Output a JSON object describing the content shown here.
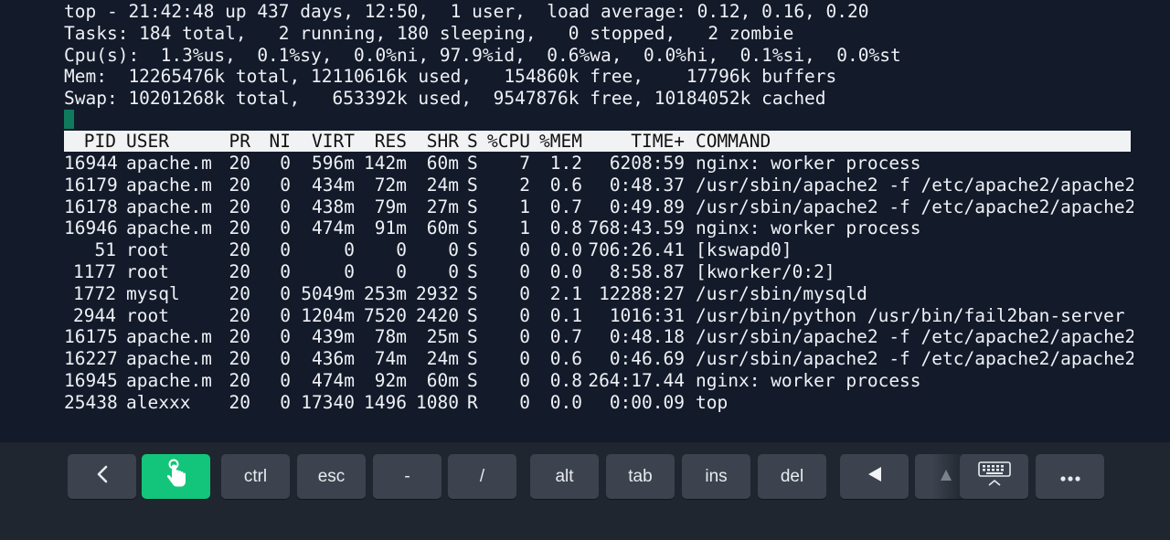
{
  "summary": {
    "line1": "top - 21:42:48 up 437 days, 12:50,  1 user,  load average: 0.12, 0.16, 0.20",
    "line2": "Tasks: 184 total,   2 running, 180 sleeping,   0 stopped,   2 zombie",
    "line3": "Cpu(s):  1.3%us,  0.1%sy,  0.0%ni, 97.9%id,  0.6%wa,  0.0%hi,  0.1%si,  0.0%st",
    "line4": "Mem:  12265476k total, 12110616k used,   154860k free,    17796k buffers",
    "line5": "Swap: 10201268k total,   653392k used,  9547876k free, 10184052k cached"
  },
  "columns": {
    "pid": "PID",
    "user": "USER",
    "pr": "PR",
    "ni": "NI",
    "virt": "VIRT",
    "res": "RES",
    "shr": "SHR",
    "s": "S",
    "cpu": "%CPU",
    "mem": "%MEM",
    "time": "TIME+",
    "command": "COMMAND"
  },
  "processes": [
    {
      "pid": "16944",
      "user": "apache.m",
      "pr": "20",
      "ni": "0",
      "virt": "596m",
      "res": "142m",
      "shr": "60m",
      "s": "S",
      "cpu": "7",
      "mem": "1.2",
      "time": "6208:59",
      "command": "nginx: worker process"
    },
    {
      "pid": "16179",
      "user": "apache.m",
      "pr": "20",
      "ni": "0",
      "virt": "434m",
      "res": "72m",
      "shr": "24m",
      "s": "S",
      "cpu": "2",
      "mem": "0.6",
      "time": "0:48.37",
      "command": "/usr/sbin/apache2 -f /etc/apache2/apache2."
    },
    {
      "pid": "16178",
      "user": "apache.m",
      "pr": "20",
      "ni": "0",
      "virt": "438m",
      "res": "79m",
      "shr": "27m",
      "s": "S",
      "cpu": "1",
      "mem": "0.7",
      "time": "0:49.89",
      "command": "/usr/sbin/apache2 -f /etc/apache2/apache2."
    },
    {
      "pid": "16946",
      "user": "apache.m",
      "pr": "20",
      "ni": "0",
      "virt": "474m",
      "res": "91m",
      "shr": "60m",
      "s": "S",
      "cpu": "1",
      "mem": "0.8",
      "time": "768:43.59",
      "command": "nginx: worker process"
    },
    {
      "pid": "51",
      "user": "root",
      "pr": "20",
      "ni": "0",
      "virt": "0",
      "res": "0",
      "shr": "0",
      "s": "S",
      "cpu": "0",
      "mem": "0.0",
      "time": "706:26.41",
      "command": "[kswapd0]"
    },
    {
      "pid": "1177",
      "user": "root",
      "pr": "20",
      "ni": "0",
      "virt": "0",
      "res": "0",
      "shr": "0",
      "s": "S",
      "cpu": "0",
      "mem": "0.0",
      "time": "8:58.87",
      "command": "[kworker/0:2]"
    },
    {
      "pid": "1772",
      "user": "mysql",
      "pr": "20",
      "ni": "0",
      "virt": "5049m",
      "res": "253m",
      "shr": "2932",
      "s": "S",
      "cpu": "0",
      "mem": "2.1",
      "time": "12288:27",
      "command": "/usr/sbin/mysqld"
    },
    {
      "pid": "2944",
      "user": "root",
      "pr": "20",
      "ni": "0",
      "virt": "1204m",
      "res": "7520",
      "shr": "2420",
      "s": "S",
      "cpu": "0",
      "mem": "0.1",
      "time": "1016:31",
      "command": "/usr/bin/python /usr/bin/fail2ban-server -"
    },
    {
      "pid": "16175",
      "user": "apache.m",
      "pr": "20",
      "ni": "0",
      "virt": "439m",
      "res": "78m",
      "shr": "25m",
      "s": "S",
      "cpu": "0",
      "mem": "0.7",
      "time": "0:48.18",
      "command": "/usr/sbin/apache2 -f /etc/apache2/apache2."
    },
    {
      "pid": "16227",
      "user": "apache.m",
      "pr": "20",
      "ni": "0",
      "virt": "436m",
      "res": "74m",
      "shr": "24m",
      "s": "S",
      "cpu": "0",
      "mem": "0.6",
      "time": "0:46.69",
      "command": "/usr/sbin/apache2 -f /etc/apache2/apache2."
    },
    {
      "pid": "16945",
      "user": "apache.m",
      "pr": "20",
      "ni": "0",
      "virt": "474m",
      "res": "92m",
      "shr": "60m",
      "s": "S",
      "cpu": "0",
      "mem": "0.8",
      "time": "264:17.44",
      "command": "nginx: worker process"
    },
    {
      "pid": "25438",
      "user": "alexxx",
      "pr": "20",
      "ni": "0",
      "virt": "17340",
      "res": "1496",
      "shr": "1080",
      "s": "R",
      "cpu": "0",
      "mem": "0.0",
      "time": "0:00.09",
      "command": "top"
    }
  ],
  "keys": [
    {
      "name": "back-key",
      "label": "",
      "icon": "chevron-left-icon"
    },
    {
      "name": "touch-mode-key",
      "label": "",
      "icon": "touch-hand-icon",
      "active": true
    },
    {
      "name": "ctrl-key",
      "label": "ctrl"
    },
    {
      "name": "esc-key",
      "label": "esc"
    },
    {
      "name": "minus-key",
      "label": "-"
    },
    {
      "name": "slash-key",
      "label": "/"
    },
    {
      "name": "alt-key",
      "label": "alt"
    },
    {
      "name": "tab-key",
      "label": "tab"
    },
    {
      "name": "ins-key",
      "label": "ins"
    },
    {
      "name": "del-key",
      "label": "del"
    },
    {
      "name": "left-arrow-key",
      "label": "",
      "icon": "arrow-left-icon"
    },
    {
      "name": "up-arrow-key",
      "label": "",
      "icon": "arrow-up-icon"
    },
    {
      "name": "keyboard-toggle-key",
      "label": "",
      "icon": "keyboard-hide-icon"
    },
    {
      "name": "more-key",
      "label": "",
      "icon": "more-dots-icon"
    }
  ],
  "colors": {
    "terminal_bg": "#131a2a",
    "terminal_fg": "#eef1f5",
    "cursor": "#0f7a5c",
    "keybar_bg": "#20262f",
    "key_bg": "#3c434e",
    "key_active": "#13c57a"
  }
}
